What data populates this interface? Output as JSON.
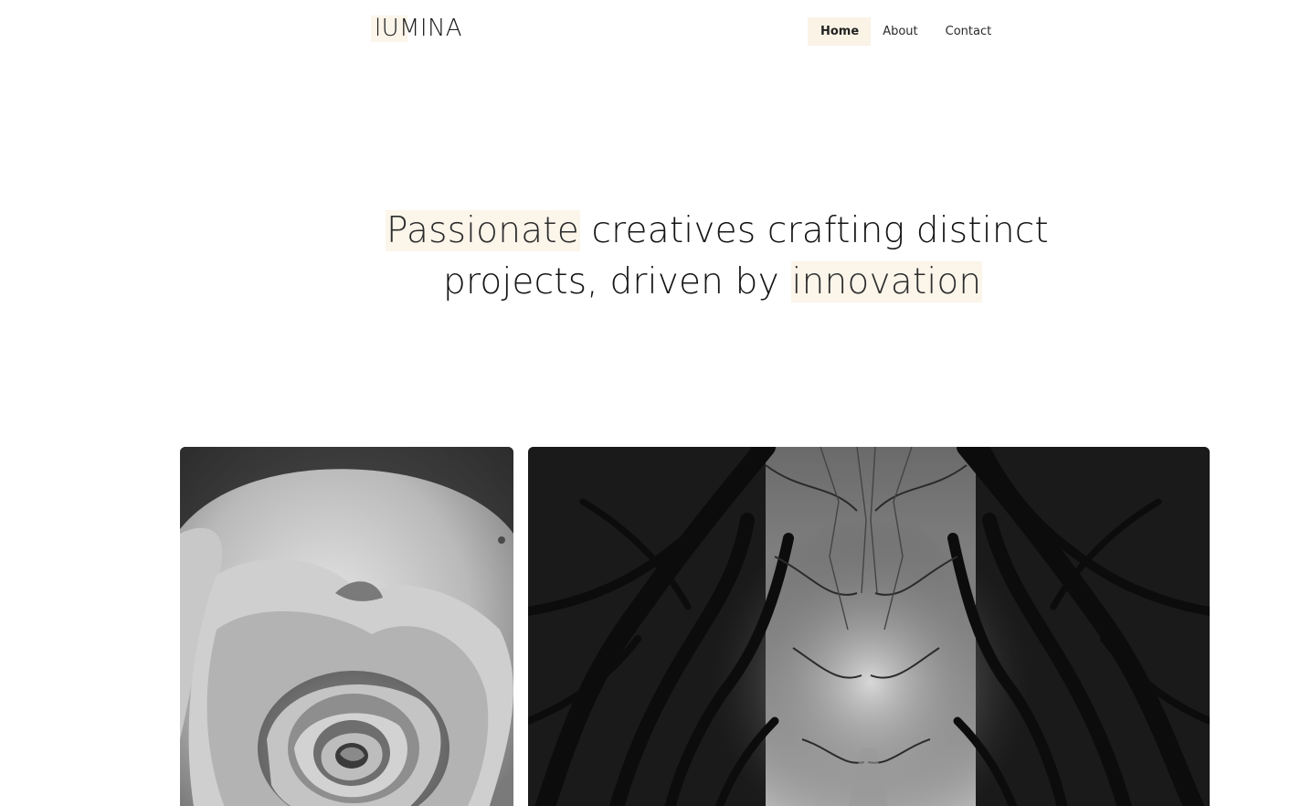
{
  "brand": {
    "logo_text": "lUMINA",
    "accent_color": "#fbf5ea"
  },
  "nav": {
    "items": [
      {
        "label": "Home",
        "active": true
      },
      {
        "label": "About",
        "active": false
      },
      {
        "label": "Contact",
        "active": false
      }
    ]
  },
  "hero": {
    "line1": {
      "highlight": "Passionate",
      "rest": " creatives crafting distinct"
    },
    "line2": {
      "rest": "projects, driven by ",
      "highlight": "innovation"
    }
  },
  "gallery": {
    "items": [
      {
        "subject": "rose",
        "icon": "rose-photo"
      },
      {
        "subject": "trees",
        "icon": "tree-tunnel-photo"
      }
    ]
  }
}
